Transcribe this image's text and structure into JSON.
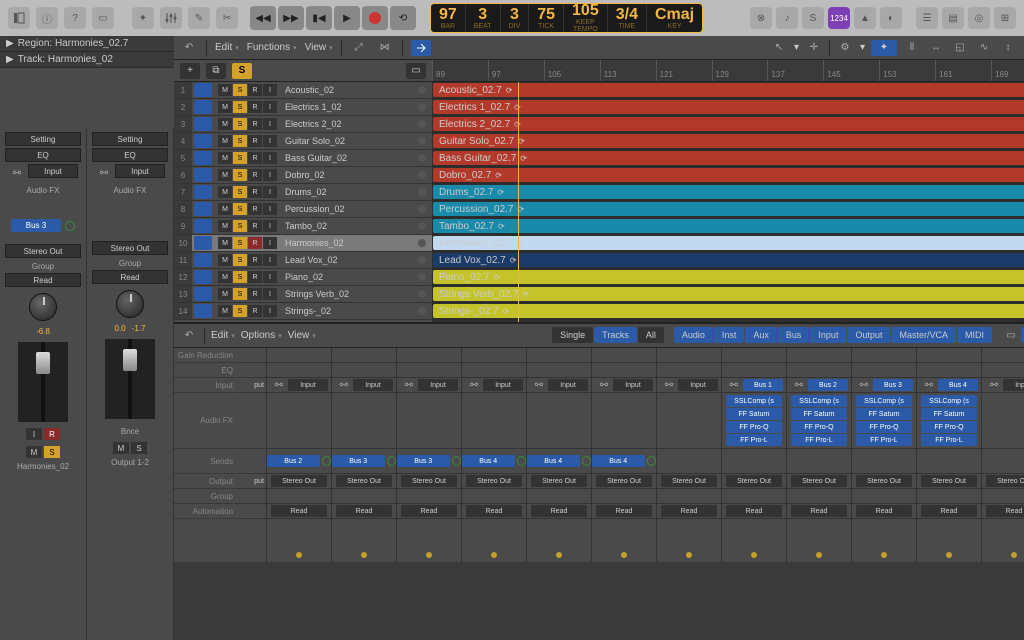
{
  "inspector": {
    "region_label": "Region: Harmonies_02.7",
    "track_label": "Track: Harmonies_02"
  },
  "lcd": {
    "bar": "97",
    "bar_lbl": "BAR",
    "beat": "3",
    "beat_lbl": "BEAT",
    "div": "3",
    "div_lbl": "DIV",
    "tick": "75",
    "tick_lbl": "TICK",
    "tempo": "105",
    "tempo_lbl": "TEMPO",
    "tempo_mode": "KEEP",
    "sig": "3/4",
    "sig_lbl": "TIME",
    "key": "Cmaj",
    "key_lbl": "KEY"
  },
  "purple_label": "1234",
  "arr_menus": {
    "edit": "Edit",
    "functions": "Functions",
    "view": "View"
  },
  "ruler": [
    "89",
    "97",
    "105",
    "113",
    "121",
    "129",
    "137",
    "145",
    "153",
    "161",
    "169"
  ],
  "tracks": [
    {
      "n": "1",
      "name": "Acoustic_02",
      "region": "Acoustic_02.7",
      "color": "r-red",
      "solo": true
    },
    {
      "n": "2",
      "name": "Electrics 1_02",
      "region": "Electrics 1_02.7",
      "color": "r-red",
      "solo": true
    },
    {
      "n": "3",
      "name": "Electrics 2_02",
      "region": "Electrics 2_02.7",
      "color": "r-red",
      "solo": true
    },
    {
      "n": "4",
      "name": "Guitar Solo_02",
      "region": "Guitar Solo_02.7",
      "color": "r-red",
      "solo": true
    },
    {
      "n": "5",
      "name": "Bass Guitar_02",
      "region": "Bass Guitar_02.7",
      "color": "r-red",
      "solo": true
    },
    {
      "n": "6",
      "name": "Dobro_02",
      "region": "Dobro_02.7",
      "color": "r-red",
      "solo": true
    },
    {
      "n": "7",
      "name": "Drums_02",
      "region": "Drums_02.7",
      "color": "r-cyan",
      "solo": true
    },
    {
      "n": "8",
      "name": "Percussion_02",
      "region": "Percussion_02.7",
      "color": "r-cyan",
      "solo": true
    },
    {
      "n": "9",
      "name": "Tambo_02",
      "region": "Tambo_02.7",
      "color": "r-cyan",
      "solo": true
    },
    {
      "n": "10",
      "name": "Harmonies_02",
      "region": "Harmonies_02.7",
      "color": "r-lblue",
      "solo": true,
      "sel": true,
      "rec": true
    },
    {
      "n": "11",
      "name": "Lead Vox_02",
      "region": "Lead Vox_02.7",
      "color": "r-navy",
      "solo": true
    },
    {
      "n": "12",
      "name": "Piano_02",
      "region": "Piano_02.7",
      "color": "r-yellow",
      "solo": true
    },
    {
      "n": "13",
      "name": "Strings Verb_02",
      "region": "Strings Verb_02.7",
      "color": "r-yellow",
      "solo": true
    },
    {
      "n": "14",
      "name": "Strings-_02",
      "region": "Strings-_02.7",
      "color": "r-yellow",
      "solo": true
    }
  ],
  "strip1": {
    "setting": "Setting",
    "eq": "EQ",
    "input": "Input",
    "audiofx": "Audio FX",
    "bus": "Bus 3",
    "stereo": "Stereo Out",
    "group": "Group",
    "read": "Read",
    "pan": "-6.8",
    "name": "Harmonies_02",
    "m": "M",
    "s": "S",
    "i": "I",
    "r": "R"
  },
  "strip2": {
    "setting": "Setting",
    "eq": "EQ",
    "input": "Input",
    "audiofx": "Audio FX",
    "stereo": "Stereo Out",
    "group": "Group",
    "read": "Read",
    "pan": "0.0",
    "pan2": "-1.7",
    "name": "Output 1-2",
    "m": "M",
    "s": "S",
    "bnce": "Bnce"
  },
  "mixer": {
    "menus": {
      "edit": "Edit",
      "options": "Options",
      "view": "View"
    },
    "tabs_mode": {
      "single": "Single",
      "tracks": "Tracks",
      "all": "All"
    },
    "tabs_type": [
      "Audio",
      "Inst",
      "Aux",
      "Bus",
      "Input",
      "Output",
      "Master/VCA",
      "MIDI"
    ],
    "rows": {
      "gain": "Gain Reduction",
      "eq": "EQ",
      "input": "Input",
      "audiofx": "Audio FX",
      "sends": "Sends",
      "output": "Output",
      "group": "Group",
      "automation": "Automation"
    },
    "input_lbl": "Input",
    "stereo": "Stereo Out",
    "read": "Read",
    "put": "put",
    "sends": [
      "Bus 2",
      "Bus 3",
      "Bus 3",
      "Bus 4",
      "Bus 4",
      "Bus 4"
    ],
    "bus_inputs": [
      "Bus 1",
      "Bus 2",
      "Bus 3",
      "Bus 4"
    ],
    "fx": [
      "SSLComp (s",
      "FF Saturn",
      "FF Pro-Q",
      "FF Pro-L"
    ]
  }
}
